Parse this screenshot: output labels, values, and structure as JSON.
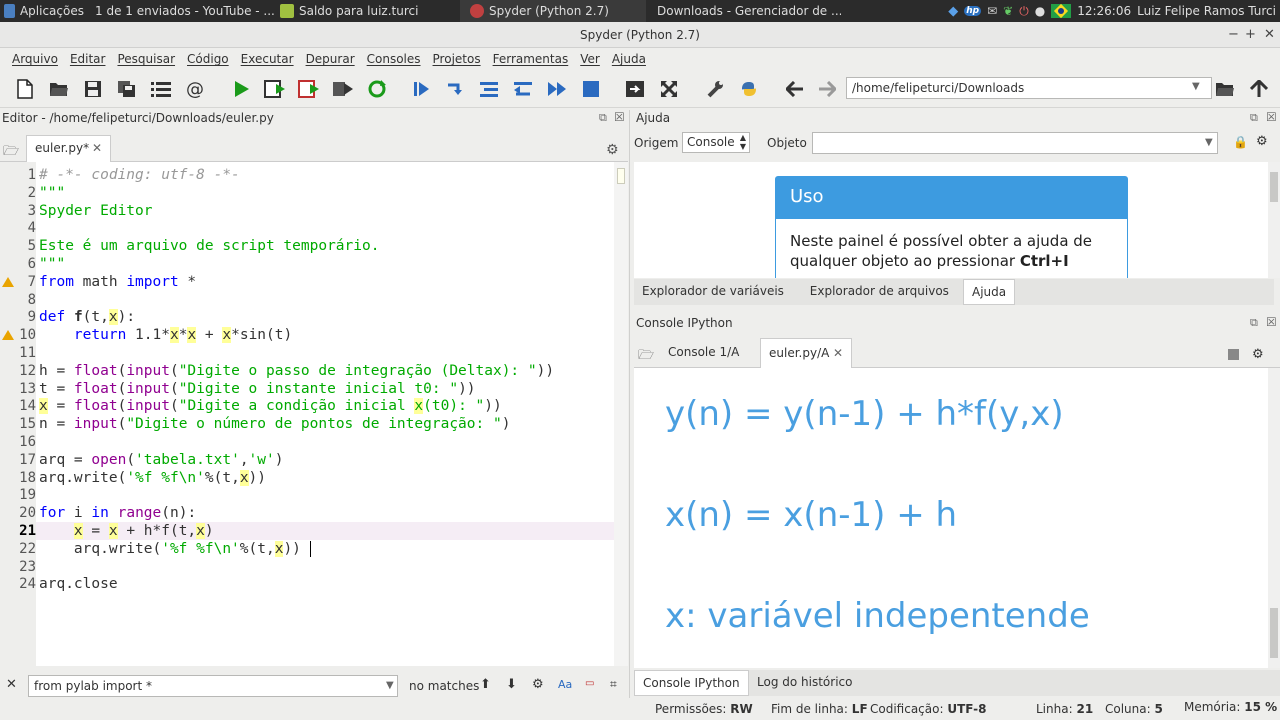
{
  "taskbar": {
    "items": [
      {
        "label": "Aplicações",
        "color": "#4a7fc0"
      },
      {
        "label": "1 de 1 enviados - YouTube - ...",
        "color": "#e04a3a"
      },
      {
        "label": "Saldo para luiz.turci",
        "color": "#a0c040"
      },
      {
        "label": "Spyder (Python 2.7)",
        "color": "#c04040"
      },
      {
        "label": "Downloads - Gerenciador de ...",
        "color": "#8a7050"
      }
    ],
    "clock": "12:26:06",
    "user": "Luiz Felipe Ramos Turci",
    "tray_icons": [
      "dropbox-icon",
      "hp-icon",
      "mail-icon",
      "leaf-icon",
      "power-icon",
      "chat-icon",
      "brazil-flag-icon"
    ]
  },
  "window": {
    "title": "Spyder (Python 2.7)",
    "controls": [
      "−",
      "+",
      "✕"
    ]
  },
  "menu": [
    "Arquivo",
    "Editar",
    "Pesquisar",
    "Código",
    "Executar",
    "Depurar",
    "Consoles",
    "Projetos",
    "Ferramentas",
    "Ver",
    "Ajuda"
  ],
  "toolbar": {
    "path": "/home/felipeturci/Downloads"
  },
  "editor": {
    "title": "Editor - /home/felipeturci/Downloads/euler.py",
    "tab": "euler.py*",
    "current_line": 21,
    "lines": [
      {
        "n": "1",
        "html": "<span class='cm'># -*- coding: utf-8 -*-</span>"
      },
      {
        "n": "2",
        "html": "<span class='st'>\"\"\"</span>"
      },
      {
        "n": "3",
        "html": "<span class='st'>Spyder Editor</span>"
      },
      {
        "n": "4",
        "html": ""
      },
      {
        "n": "5",
        "html": "<span class='st'>Este é um arquivo de script temporário.</span>"
      },
      {
        "n": "6",
        "html": "<span class='st'>\"\"\"</span>"
      },
      {
        "n": "7",
        "html": "<span class='kw'>from</span> math <span class='kw'>import</span> *",
        "warn": true
      },
      {
        "n": "8",
        "html": ""
      },
      {
        "n": "9",
        "html": "<span class='kw'>def</span> <b>f</b>(t,<span class='hl'>x</span>):"
      },
      {
        "n": "10",
        "html": "    <span class='kw'>return</span> 1.1*<span class='hl'>x</span>*<span class='hl'>x</span> + <span class='hl'>x</span>*sin(t)",
        "warn": true
      },
      {
        "n": "11",
        "html": ""
      },
      {
        "n": "12",
        "html": "h = <span class='bi'>float</span>(<span class='bi'>input</span>(<span class='st'>\"Digite o passo de integração (Deltax): \"</span>))"
      },
      {
        "n": "13",
        "html": "t = <span class='bi'>float</span>(<span class='bi'>input</span>(<span class='st'>\"Digite o instante inicial t0: \"</span>))"
      },
      {
        "n": "14",
        "html": "<span class='hl'>x</span> = <span class='bi'>float</span>(<span class='bi'>input</span>(<span class='st'>\"Digite a condição inicial <span class='hl'>x</span>(t0): \"</span>))"
      },
      {
        "n": "15",
        "html": "n = <span class='bi'>input</span>(<span class='st'>\"Digite o número de pontos de integração: \"</span>)"
      },
      {
        "n": "16",
        "html": ""
      },
      {
        "n": "17",
        "html": "arq = <span class='bi'>open</span>(<span class='st'>'tabela.txt'</span>,<span class='st'>'w'</span>)"
      },
      {
        "n": "18",
        "html": "arq.write(<span class='st'>'%f %f\\n'</span>%(t,<span class='hl'>x</span>))"
      },
      {
        "n": "19",
        "html": ""
      },
      {
        "n": "20",
        "html": "<span class='kw'>for</span> i <span class='kw'>in</span> <span class='bi'>range</span>(n):"
      },
      {
        "n": "21",
        "html": "    <span class='hl'>x</span> = <span class='hl'>x</span> + h*f(t,<span class='hl'>x</span>)"
      },
      {
        "n": "22",
        "html": "    arq.write(<span class='st'>'%f %f\\n'</span>%(t,<span class='hl'>x</span>))"
      },
      {
        "n": "23",
        "html": ""
      },
      {
        "n": "24",
        "html": "arq.close"
      }
    ]
  },
  "find": {
    "value": "from pylab import *",
    "result": "no matches"
  },
  "help": {
    "title": "Ajuda",
    "source_label": "Origem",
    "source_value": "Console",
    "object_label": "Objeto",
    "card_title": "Uso",
    "card_text_1": "Neste painel é possível obter a ajuda de",
    "card_text_2": "qualquer objeto ao pressionar ",
    "card_text_bold": "Ctrl+I",
    "tabs": [
      "Explorador de variáveis",
      "Explorador de arquivos",
      "Ajuda"
    ],
    "active_tab": 2
  },
  "console": {
    "title": "Console IPython",
    "tabs": [
      "Console 1/A",
      "euler.py/A"
    ],
    "active_tab": 1,
    "lines": [
      "y(n) = y(n-1) + h*f(y,x)",
      "x(n) = x(n-1) + h",
      "x: variável indepentende"
    ],
    "bottom_tabs": [
      "Console IPython",
      "Log do histórico"
    ],
    "active_bottom_tab": 0
  },
  "status": {
    "permissions_label": "Permissões:",
    "permissions": "RW",
    "eol_label": "Fim de linha:",
    "eol": "LF",
    "encoding_label": "Codificação:",
    "encoding": "UTF-8",
    "line_label": "Linha:",
    "line": "21",
    "column_label": "Coluna:",
    "column": "5",
    "memory_label": "Memória:",
    "memory": "15 %"
  },
  "colors": {
    "accent_blue": "#3d9be0",
    "console_text": "#4a9fe0",
    "run_green": "#1a9a1a"
  }
}
